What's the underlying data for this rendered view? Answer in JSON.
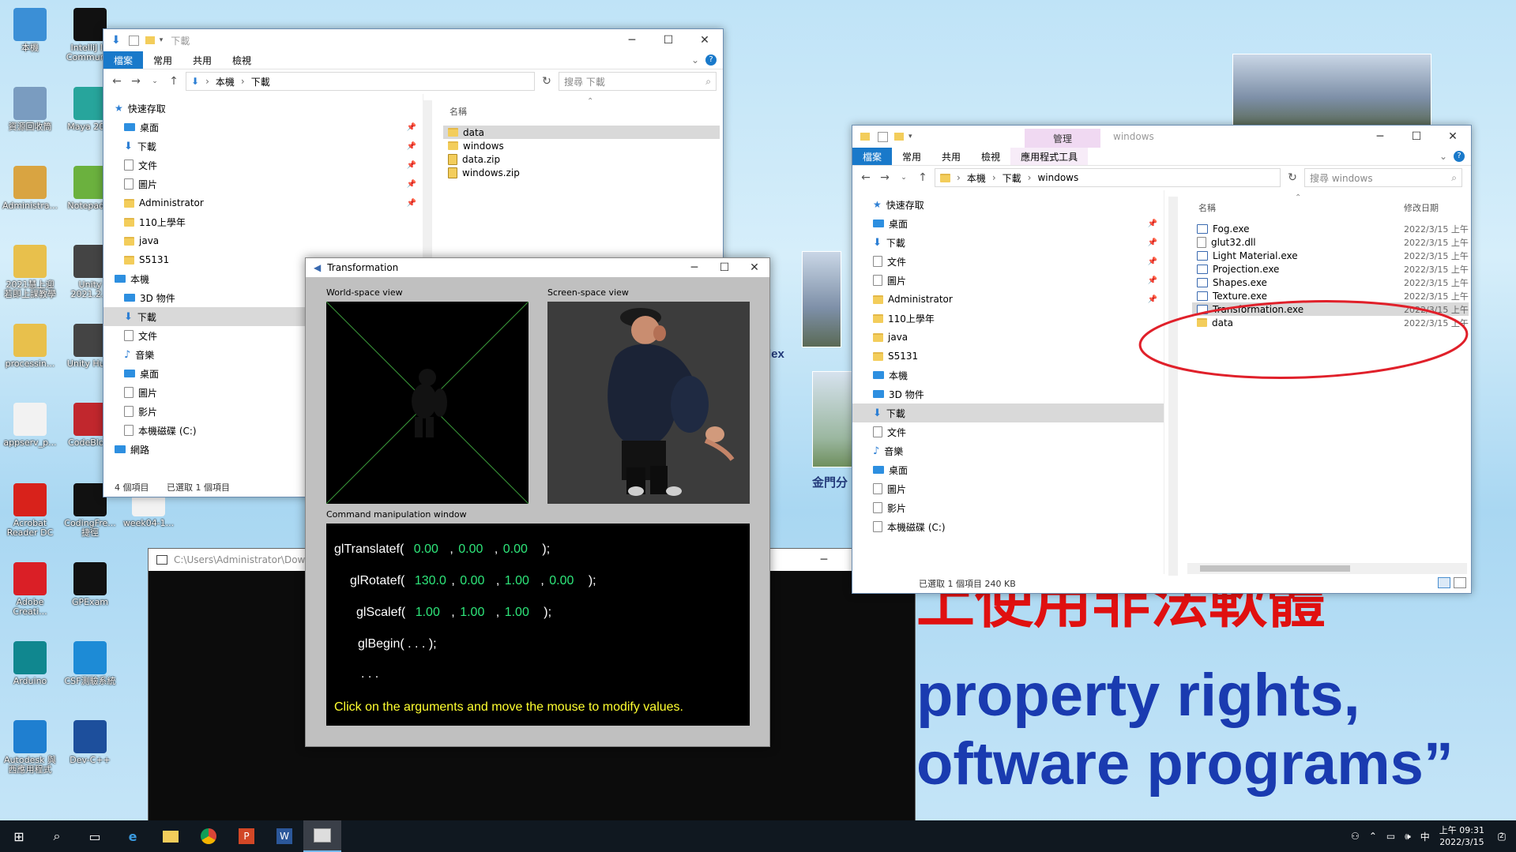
{
  "wallpaper": {
    "red_text": "上使用非法軟體",
    "blue_line1": "property rights,",
    "blue_line2": "oftware programs”",
    "partial_label1": "lex",
    "partial_label2": "金門分"
  },
  "desktop_icons": [
    {
      "label": "本機",
      "icon": "computer-icon",
      "color": "#3b8fd6"
    },
    {
      "label": "資源回收筒",
      "icon": "recycle-bin-icon",
      "color": "#7a9cc0"
    },
    {
      "label": "Administra...",
      "icon": "user-folder-icon",
      "color": "#d9a441"
    },
    {
      "label": "2021慧上迎\n若即上課教學",
      "icon": "folder-icon",
      "color": "#e8c04c"
    },
    {
      "label": "processin...",
      "icon": "folder-icon",
      "color": "#e8c04c"
    },
    {
      "label": "appserv_p...",
      "icon": "document-icon",
      "color": "#f2f2f2"
    },
    {
      "label": "Acrobat\nReader DC",
      "icon": "acrobat-icon",
      "color": "#d8221b"
    },
    {
      "label": "Adobe\nCreati...",
      "icon": "creative-cloud-icon",
      "color": "#da1f26"
    },
    {
      "label": "Arduino",
      "icon": "arduino-icon",
      "color": "#10878f"
    },
    {
      "label": "Autodesk 與\n西應用程式",
      "icon": "autodesk-icon",
      "color": "#1f7fd0"
    },
    {
      "label": "IntelliJ ID\nCommun...",
      "icon": "intellij-icon",
      "color": "#111111"
    },
    {
      "label": "Maya 20...",
      "icon": "maya-icon",
      "color": "#27a59c"
    },
    {
      "label": "Notepad...",
      "icon": "notepad-icon",
      "color": "#6bb13e"
    },
    {
      "label": "Unity\n2021.2.1",
      "icon": "unity-icon",
      "color": "#444444"
    },
    {
      "label": "Unity Hu...",
      "icon": "unity-hub-icon",
      "color": "#444444"
    },
    {
      "label": "CodeBlo...",
      "icon": "codeblocks-icon",
      "color": "#c1272d"
    },
    {
      "label": "CodingFre...\n捷徑",
      "icon": "codingfrenzy-icon",
      "color": "#111111"
    },
    {
      "label": "week04-1...",
      "icon": "screenshot-icon",
      "color": "#f2f2f2"
    },
    {
      "label": "GPExam",
      "icon": "gpexam-icon",
      "color": "#111111"
    },
    {
      "label": "CSF測驗系統",
      "icon": "csf-icon",
      "color": "#1d8bd6"
    },
    {
      "label": "Dev-C++",
      "icon": "devcpp-icon",
      "color": "#1d4f9c"
    }
  ],
  "explorer1": {
    "title": "下載",
    "tabs": [
      "檔案",
      "常用",
      "共用",
      "檢視"
    ],
    "path": [
      "本機",
      "下載"
    ],
    "search_placeholder": "搜尋 下載",
    "nav": [
      {
        "label": "快速存取",
        "icon": "star-icon",
        "pin": false
      },
      {
        "label": "桌面",
        "icon": "desktop-icon",
        "pin": true
      },
      {
        "label": "下載",
        "icon": "download-icon",
        "pin": true
      },
      {
        "label": "文件",
        "icon": "document-icon",
        "pin": true
      },
      {
        "label": "圖片",
        "icon": "picture-icon",
        "pin": true
      },
      {
        "label": "Administrator",
        "icon": "folder-icon",
        "pin": true
      },
      {
        "label": "110上學年",
        "icon": "folder-icon",
        "pin": false
      },
      {
        "label": "java",
        "icon": "folder-icon",
        "pin": false
      },
      {
        "label": "S5131",
        "icon": "folder-icon",
        "pin": false
      },
      {
        "label": "本機",
        "icon": "computer-icon",
        "pin": false
      },
      {
        "label": "3D 物件",
        "icon": "3d-objects-icon",
        "pin": false
      },
      {
        "label": "下載",
        "icon": "download-icon",
        "pin": false
      },
      {
        "label": "文件",
        "icon": "document-icon",
        "pin": false
      },
      {
        "label": "音樂",
        "icon": "music-icon",
        "pin": false
      },
      {
        "label": "桌面",
        "icon": "desktop-icon",
        "pin": false
      },
      {
        "label": "圖片",
        "icon": "picture-icon",
        "pin": false
      },
      {
        "label": "影片",
        "icon": "video-icon",
        "pin": false
      },
      {
        "label": "本機磁碟 (C:)",
        "icon": "drive-icon",
        "pin": false
      },
      {
        "label": "網路",
        "icon": "network-icon",
        "pin": false
      }
    ],
    "column_name": "名稱",
    "files": [
      {
        "name": "data",
        "type": "folder"
      },
      {
        "name": "windows",
        "type": "folder"
      },
      {
        "name": "data.zip",
        "type": "zip"
      },
      {
        "name": "windows.zip",
        "type": "zip"
      }
    ],
    "status_count": "4 個項目",
    "status_selected": "已選取 1 個項目"
  },
  "explorer2": {
    "title": "windows",
    "manage_tab": "管理",
    "tabs": [
      "檔案",
      "常用",
      "共用",
      "檢視",
      "應用程式工具"
    ],
    "path": [
      "本機",
      "下載",
      "windows"
    ],
    "search_placeholder": "搜尋 windows",
    "nav": [
      {
        "label": "快速存取",
        "icon": "star-icon",
        "pin": false
      },
      {
        "label": "桌面",
        "icon": "desktop-icon",
        "pin": true
      },
      {
        "label": "下載",
        "icon": "download-icon",
        "pin": true
      },
      {
        "label": "文件",
        "icon": "document-icon",
        "pin": true
      },
      {
        "label": "圖片",
        "icon": "picture-icon",
        "pin": true
      },
      {
        "label": "Administrator",
        "icon": "folder-icon",
        "pin": true
      },
      {
        "label": "110上學年",
        "icon": "folder-icon",
        "pin": false
      },
      {
        "label": "java",
        "icon": "folder-icon",
        "pin": false
      },
      {
        "label": "S5131",
        "icon": "folder-icon",
        "pin": false
      },
      {
        "label": "本機",
        "icon": "computer-icon",
        "pin": false
      },
      {
        "label": "3D 物件",
        "icon": "3d-objects-icon",
        "pin": false
      },
      {
        "label": "下載",
        "icon": "download-icon",
        "pin": false
      },
      {
        "label": "文件",
        "icon": "document-icon",
        "pin": false
      },
      {
        "label": "音樂",
        "icon": "music-icon",
        "pin": false
      },
      {
        "label": "桌面",
        "icon": "desktop-icon",
        "pin": false
      },
      {
        "label": "圖片",
        "icon": "picture-icon",
        "pin": false
      },
      {
        "label": "影片",
        "icon": "video-icon",
        "pin": false
      },
      {
        "label": "本機磁碟 (C:)",
        "icon": "drive-icon",
        "pin": false
      }
    ],
    "column_name": "名稱",
    "column_date": "修改日期",
    "files": [
      {
        "name": "Fog.exe",
        "date": "2022/3/15 上午",
        "type": "exe"
      },
      {
        "name": "glut32.dll",
        "date": "2022/3/15 上午",
        "type": "dll"
      },
      {
        "name": "Light Material.exe",
        "date": "2022/3/15 上午",
        "type": "exe"
      },
      {
        "name": "Projection.exe",
        "date": "2022/3/15 上午",
        "type": "exe"
      },
      {
        "name": "Shapes.exe",
        "date": "2022/3/15 上午",
        "type": "exe"
      },
      {
        "name": "Texture.exe",
        "date": "2022/3/15 上午",
        "type": "exe"
      },
      {
        "name": "Transformation.exe",
        "date": "2022/3/15 上午",
        "type": "exe"
      },
      {
        "name": "data",
        "date": "2022/3/15 上午",
        "type": "folder"
      }
    ],
    "status": "已選取 1 個項目  240 KB"
  },
  "transformation": {
    "title": "Transformation",
    "world_label": "World-space view",
    "screen_label": "Screen-space view",
    "command_label": "Command manipulation window",
    "translate": {
      "fn": "glTranslatef(",
      "a": "0.00",
      "b": "0.00",
      "c": "0.00",
      "end": ");"
    },
    "rotate": {
      "fn": "glRotatef(",
      "a": "130.0",
      "b": "0.00",
      "c": "1.00",
      "d": "0.00",
      "end": ");"
    },
    "scale": {
      "fn": "glScalef(",
      "a": "1.00",
      "b": "1.00",
      "c": "1.00",
      "end": ");"
    },
    "begin": "glBegin(  . . .  );",
    "dots": ". . .",
    "hint": "Click on the arguments and move the mouse to modify values."
  },
  "console": {
    "title": "C:\\Users\\Administrator\\Downlo"
  },
  "taskbar": {
    "time": "上午 09:31",
    "date": "2022/3/15",
    "ime": "中",
    "notifications": "2"
  },
  "colors": {
    "accent": "#1979ca",
    "wallpaper_red": "#e01010",
    "wallpaper_blue": "#1a3bb0",
    "cmd_green": "#2ee67a",
    "cmd_yellow": "#ffff30",
    "annotation_red": "#e0202a"
  }
}
